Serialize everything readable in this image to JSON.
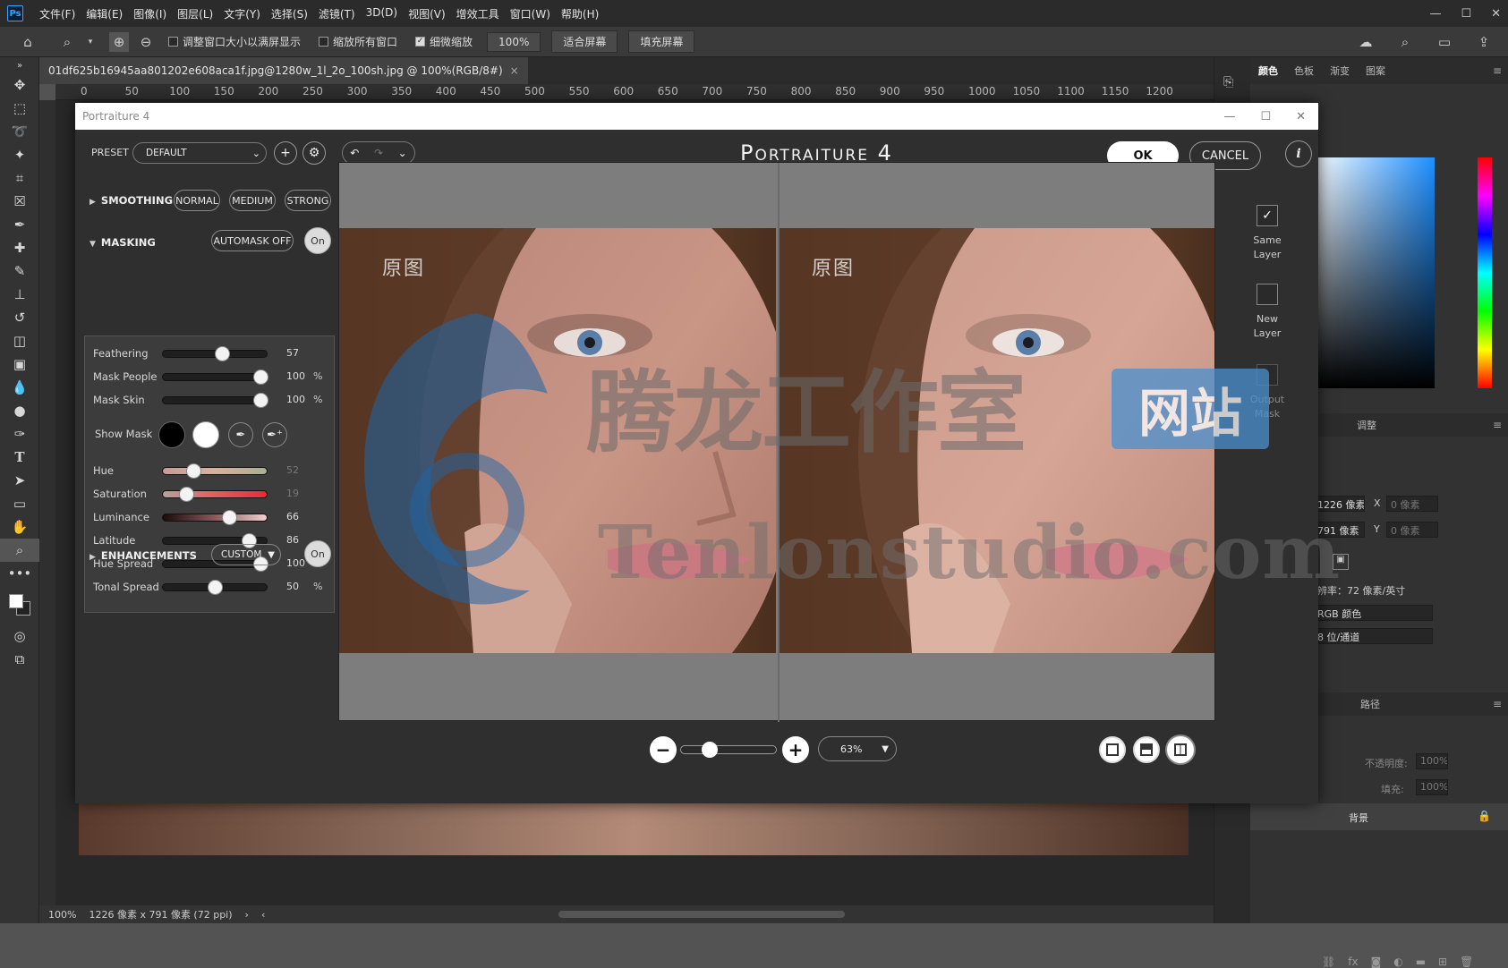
{
  "menubar": {
    "logo": "Ps",
    "items": [
      "文件(F)",
      "编辑(E)",
      "图像(I)",
      "图层(L)",
      "文字(Y)",
      "选择(S)",
      "滤镜(T)",
      "3D(D)",
      "视图(V)",
      "增效工具",
      "窗口(W)",
      "帮助(H)"
    ]
  },
  "options": {
    "resize_windows": "调整窗口大小以满屏显示",
    "zoom_all": "缩放所有窗口",
    "scrubby_zoom": "细微缩放",
    "zoom_value": "100%",
    "fit_screen": "适合屏幕",
    "fill_screen": "填充屏幕"
  },
  "document": {
    "tab_title": "01df625b16945aa801202e608aca1f.jpg@1280w_1l_2o_100sh.jpg @ 100%(RGB/8#)",
    "close": "×"
  },
  "ruler": {
    "h_ticks": [
      "0",
      "50",
      "100",
      "150",
      "200",
      "250",
      "300",
      "350",
      "400",
      "450",
      "500",
      "550",
      "600",
      "650",
      "700",
      "750",
      "800",
      "850",
      "900",
      "950",
      "1000",
      "1050",
      "1100",
      "1150",
      "1200"
    ]
  },
  "status": {
    "zoom": "100%",
    "doc_info": "1226 像素 x 791 像素 (72 ppi)"
  },
  "right_panel": {
    "tabs": [
      "颜色",
      "色板",
      "渐变",
      "图案"
    ],
    "adjust_header": "调整",
    "width_value": "1226 像素",
    "height_value": "791 像素",
    "x_label": "X",
    "y_label": "Y",
    "x_value": "0 像素",
    "y_value": "0 像素",
    "resolution": "分辨率：72 像素/英寸",
    "mode": "RGB 颜色",
    "depth": "8 位/通道",
    "paths_tab": "路径",
    "opacity_label": "不透明度:",
    "opacity_value": "100%",
    "fill_label": "填充:",
    "fill_value": "100%",
    "layer_name": "背景"
  },
  "dialog": {
    "title": "Portraiture 4",
    "brand": "Portraiture 4",
    "preset_label": "PRESET",
    "preset_value": "DEFAULT",
    "ok": "OK",
    "cancel": "CANCEL",
    "info": "i",
    "smoothing": {
      "title": "SMOOTHING",
      "options": [
        "NORMAL",
        "MEDIUM",
        "STRONG"
      ]
    },
    "masking": {
      "title": "MASKING",
      "automask": "AUTOMASK OFF",
      "toggle": "On",
      "show_mask": "Show Mask",
      "sliders": [
        {
          "label": "Feathering",
          "value": "57",
          "unit": "",
          "pos": 0.57,
          "dim": false
        },
        {
          "label": "Mask People",
          "value": "100",
          "unit": "%",
          "pos": 0.94,
          "dim": false
        },
        {
          "label": "Mask Skin",
          "value": "100",
          "unit": "%",
          "pos": 0.94,
          "dim": false
        }
      ],
      "color_sliders": [
        {
          "label": "Hue",
          "value": "52",
          "unit": "",
          "pos": 0.29,
          "dim": true,
          "grad": "hue"
        },
        {
          "label": "Saturation",
          "value": "19",
          "unit": "",
          "pos": 0.22,
          "dim": true,
          "grad": "sat"
        },
        {
          "label": "Luminance",
          "value": "66",
          "unit": "",
          "pos": 0.64,
          "dim": false,
          "grad": "lum"
        },
        {
          "label": "Latitude",
          "value": "86",
          "unit": "",
          "pos": 0.83,
          "dim": false,
          "grad": "none"
        },
        {
          "label": "Hue Spread",
          "value": "100",
          "unit": "%",
          "pos": 0.94,
          "dim": false,
          "grad": "none"
        },
        {
          "label": "Tonal Spread",
          "value": "50",
          "unit": "%",
          "pos": 0.5,
          "dim": false,
          "grad": "none"
        }
      ]
    },
    "enhancements": {
      "title": "ENHANCEMENTS",
      "value": "CUSTOM",
      "toggle": "On"
    },
    "preview": {
      "left_label": "原图",
      "right_label": "原图"
    },
    "right_strip": {
      "same_layer": "Same Layer",
      "new_layer": "New Layer",
      "output_mask": "Output Mask"
    },
    "zoom": {
      "value": "63%",
      "slider_pos": 0.3
    }
  },
  "watermark": {
    "chinese": "腾龙工作室",
    "badge": "网站",
    "url": "Tenlonstudio.com"
  },
  "colors": {
    "ps_blue": "#31a8ff",
    "dialog_bg": "#2f2f2f"
  }
}
